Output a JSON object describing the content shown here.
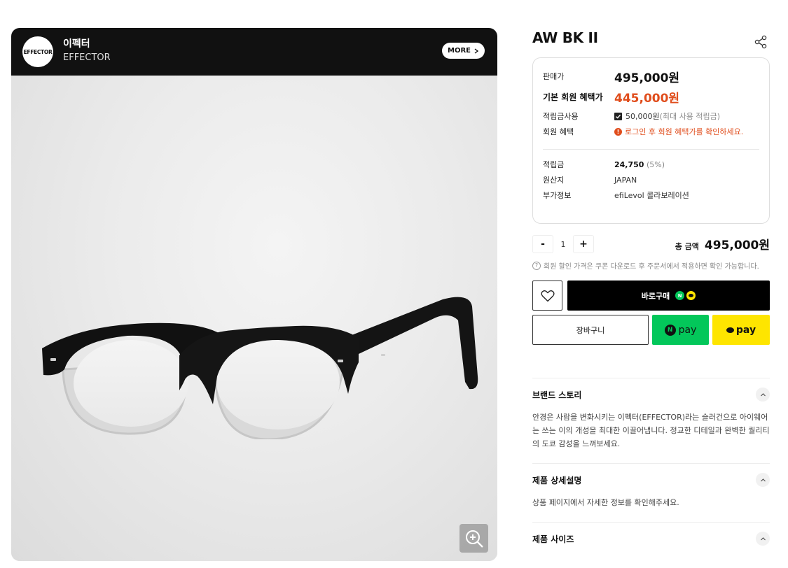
{
  "brand": {
    "logo_text": "EFFECTOR",
    "name_ko": "이펙터",
    "name_en": "EFFECTOR",
    "more_label": "MORE"
  },
  "product": {
    "title": "AW BK II"
  },
  "prices": {
    "sale_label": "판매가",
    "sale_value": "495,000원",
    "member_label": "기본 회원 혜택가",
    "member_value": "445,000원",
    "points_use_label": "적립금사용",
    "points_use_value": "50,000원",
    "points_use_note": "(최대 사용 적립금)",
    "benefit_label": "회원 혜택",
    "benefit_notice": "로그인 후 회원 혜택가를 확인하세요.",
    "reward_label": "적립금",
    "reward_value": "24,750",
    "reward_rate": "(5%)",
    "origin_label": "원산지",
    "origin_value": "JAPAN",
    "extra_label": "부가정보",
    "extra_value": "efiLevol 콜라보레이션"
  },
  "quantity": {
    "minus": "-",
    "value": "1",
    "plus": "+"
  },
  "total": {
    "label": "총 금액",
    "value": "495,000원"
  },
  "hint": "회원 할인 가격은 쿠폰 다운로드 후 주문서에서 적용하면 확인 가능합니다.",
  "buttons": {
    "buy": "바로구매",
    "cart": "장바구니",
    "npay": "pay",
    "kpay": "pay",
    "n_letter": "N"
  },
  "accordion": [
    {
      "title": "브랜드 스토리",
      "body": "안경은 사람을 변화시키는 이펙터(EFFECTOR)라는 슬러건으로 아이웨어는 쓰는 이의 개성을 최대한 이끌어냅니다. 정교한 디테일과 완벽한 퀄리티의 도쿄 감성을 느껴보세요."
    },
    {
      "title": "제품 상세설명",
      "body": "상품 페이지에서 자세한 정보를 확인해주세요."
    },
    {
      "title": "제품 사이즈",
      "body": ""
    }
  ],
  "colors": {
    "accent": "#e04d1c",
    "naver": "#03c75a",
    "kakao": "#fee500"
  },
  "icons": [
    "share-icon",
    "zoom-in-icon",
    "heart-icon",
    "chevron-right-icon",
    "chevron-up-icon",
    "check-icon",
    "info-icon",
    "question-icon"
  ]
}
